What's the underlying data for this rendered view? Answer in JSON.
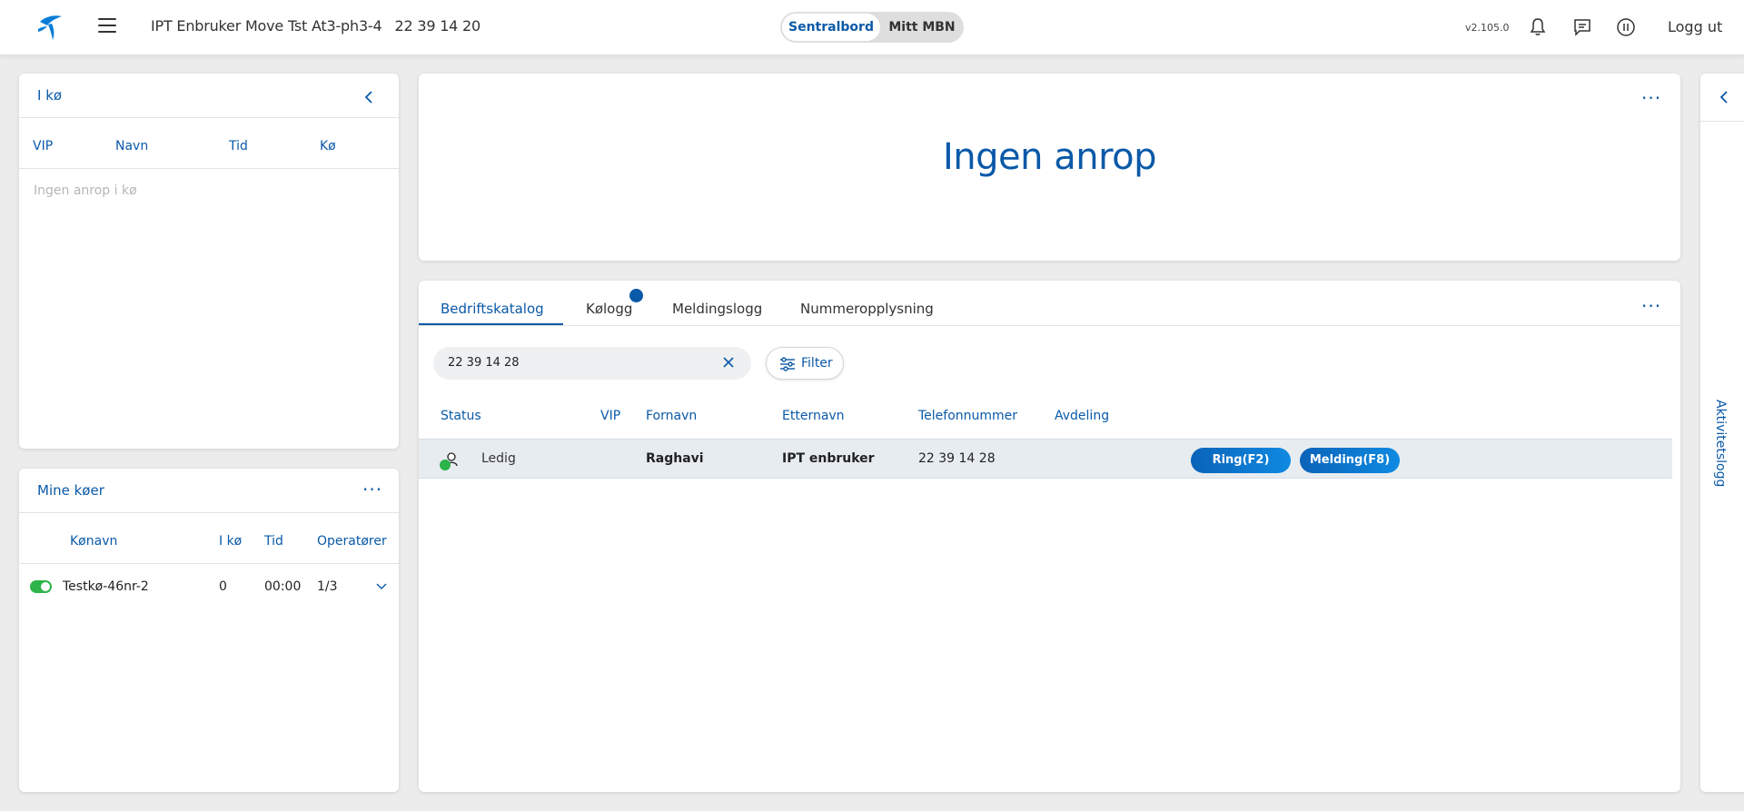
{
  "header": {
    "user_name": "IPT Enbruker Move Tst At3-ph3-4",
    "user_number": "22 39 14 20",
    "toggle": {
      "active": "Sentralbord",
      "inactive": "Mitt MBN"
    },
    "version": "v2.105.0",
    "logout_label": "Logg ut",
    "icons": [
      "bell-icon",
      "chat-icon",
      "pause-icon"
    ]
  },
  "queue_panel": {
    "title": "I kø",
    "columns": [
      "VIP",
      "Navn",
      "Tid",
      "Kø"
    ],
    "empty_message": "Ingen anrop i kø"
  },
  "my_queues": {
    "title": "Mine køer",
    "columns": [
      "Kønavn",
      "I kø",
      "Tid",
      "Operatører"
    ],
    "rows": [
      {
        "enabled": true,
        "name": "Testkø-46nr-2",
        "in_queue": "0",
        "time": "00:00",
        "operators": "1/3"
      }
    ]
  },
  "call_panel": {
    "message": "Ingen anrop"
  },
  "directory": {
    "tabs": [
      "Bedriftskatalog",
      "Kølogg",
      "Meldingslogg",
      "Nummeropplysning"
    ],
    "active_tab": "Bedriftskatalog",
    "search": {
      "value": "22 39 14 28"
    },
    "filter_label": "Filter",
    "columns": [
      "Status",
      "VIP",
      "Fornavn",
      "Etternavn",
      "Telefonnummer",
      "Avdeling"
    ],
    "rows": [
      {
        "status": "Ledig",
        "status_color": "#2cb34a",
        "vip": "",
        "first_name": "Raghavi",
        "last_name": "IPT enbruker",
        "phone": "22 39 14 28",
        "department": "",
        "actions": {
          "ring": "Ring(F2)",
          "message": "Melding(F8)"
        }
      }
    ]
  },
  "side_panel": {
    "title": "Aktivitetslogg"
  },
  "colors": {
    "accent": "#0a59a8",
    "status_available": "#2cb34a",
    "background": "#ececec"
  }
}
